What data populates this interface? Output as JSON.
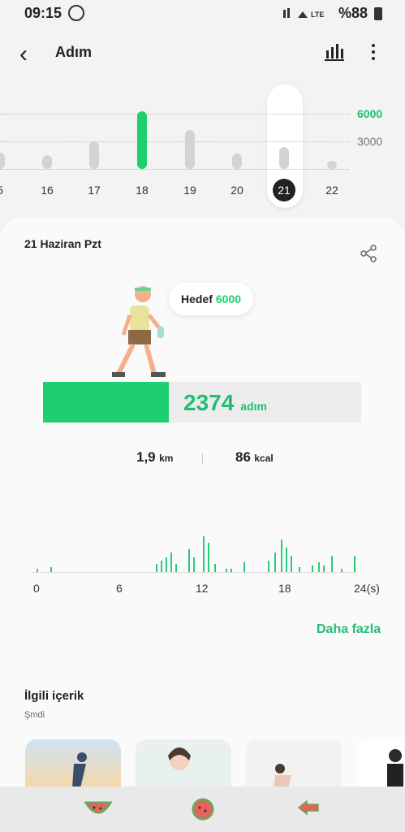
{
  "status": {
    "time": "09:15",
    "battery": "%88"
  },
  "header": {
    "title": "Adım"
  },
  "week": {
    "goal_label": "6000",
    "mid_label": "3000",
    "days": [
      "5",
      "16",
      "17",
      "18",
      "19",
      "20",
      "21",
      "22"
    ],
    "selected": "21",
    "values": [
      1800,
      1500,
      3000,
      6300,
      4200,
      1700,
      2374,
      200
    ]
  },
  "day": {
    "date": "21 Haziran Pzt",
    "goal_prefix": "Hedef",
    "goal_value": "6000",
    "steps": "2374",
    "steps_unit": "adım",
    "progress": 0.396,
    "distance": "1,9",
    "distance_unit": "km",
    "calories": "86",
    "calories_unit": "kcal",
    "axis": [
      "0",
      "6",
      "12",
      "18",
      "24(s)"
    ],
    "more": "Daha fazla"
  },
  "related": {
    "title": "İlgili içerik",
    "subtitle": "Şmdi"
  },
  "colors": {
    "accent": "#1fcf6f",
    "accent_text": "#1fbf74"
  }
}
